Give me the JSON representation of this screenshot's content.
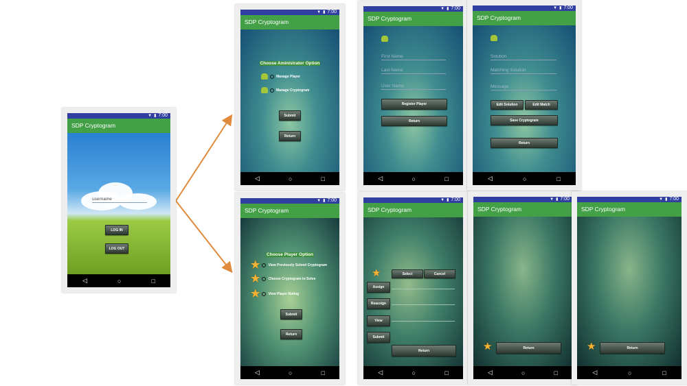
{
  "status_time": "7:00",
  "app_title": "SDP Cryptogram",
  "nav": {
    "back": "◁",
    "home": "○",
    "recent": "□"
  },
  "icons": {
    "wifi": "wifi-icon",
    "battery": "battery-icon",
    "android": "android-icon",
    "star": "star-icon"
  },
  "colors": {
    "status_bar": "#303f9f",
    "app_bar": "#43a047",
    "arrow": "#e08a3c"
  },
  "login": {
    "username_placeholder": "username",
    "login_label": "LOG IN",
    "logout_label": "LOG OUT"
  },
  "admin": {
    "heading": "Choose Aministrator Option",
    "options": [
      "Manage Player",
      "Manage Cryptogram"
    ],
    "submit_label": "Submit",
    "return_label": "Return"
  },
  "register": {
    "fields": [
      "First Name",
      "Last Name",
      "User Name"
    ],
    "register_label": "Register Player",
    "return_label": "Return"
  },
  "edit": {
    "fields": [
      "Solution",
      "Matching Solution",
      "Message"
    ],
    "edit_solution_label": "Edit Solution",
    "edit_match_label": "Edit Match",
    "save_label": "Save Cryptogram",
    "return_label": "Return"
  },
  "player": {
    "heading": "Choose Player Option",
    "options": [
      "View Previously Solved Cryptogram",
      "Choose Cryptogram to Solve",
      "View Player Rating"
    ],
    "submit_label": "Submit",
    "return_label": "Return"
  },
  "solve": {
    "select_label": "Select",
    "cancel_label": "Cancel",
    "side_buttons": [
      "Assign",
      "Reassign",
      "View",
      "Submit"
    ],
    "return_label": "Return"
  },
  "list1": {
    "return_label": "Return"
  },
  "list2": {
    "return_label": "Return"
  }
}
